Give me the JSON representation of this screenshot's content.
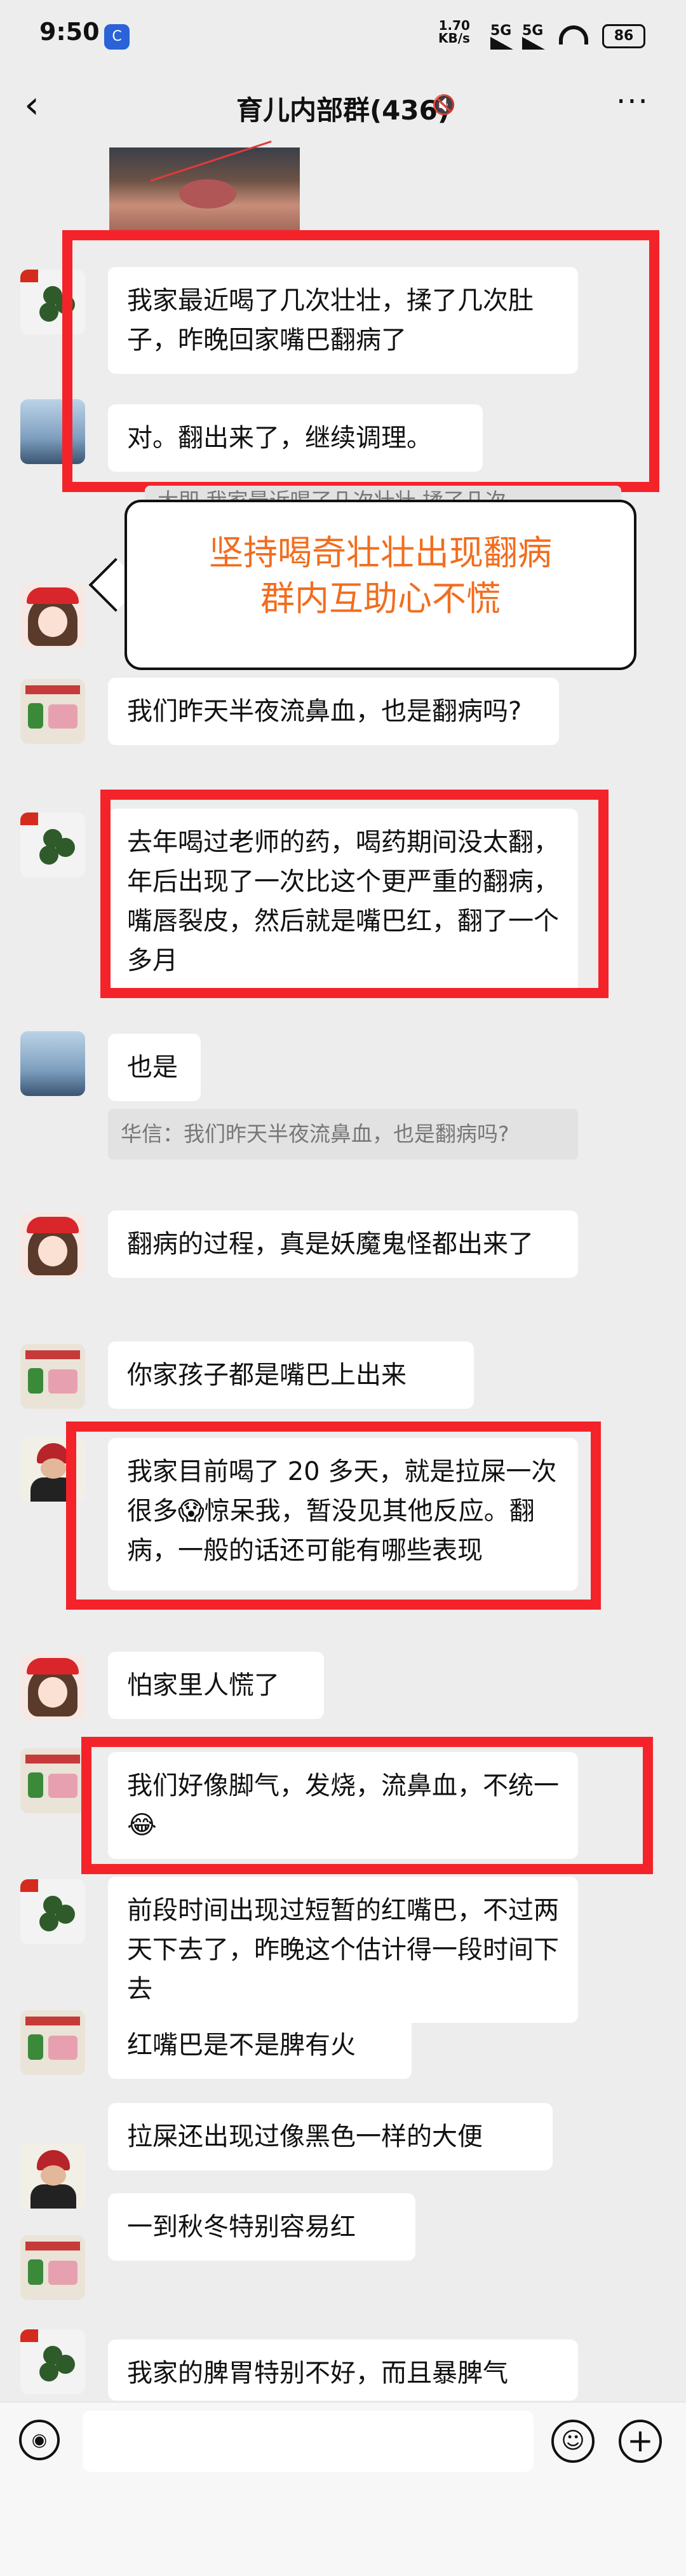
{
  "status": {
    "time": "9:50",
    "app_badge": "C",
    "net_speed": "1.70\nKB/s",
    "sig1": "5G",
    "sig2": "5G",
    "battery": "86"
  },
  "nav": {
    "title": "育儿内部群(436)",
    "back": "‹",
    "more": "···",
    "title_icons": "🔇"
  },
  "callout": {
    "line1": "坚持喝奇壮壮出现翻病",
    "line2": "群内互助心不慌"
  },
  "messages": [
    {
      "text": "我家最近喝了几次壮壮，揉了几次肚子，昨晚回家嘴巴翻病了"
    },
    {
      "text": "对。翻出来了，继续调理。"
    },
    {
      "text": "大即 我家最近喝了几次壮壮 揉了几次"
    },
    {
      "text": "我们昨天半夜流鼻血，也是翻病吗?"
    },
    {
      "text": "去年喝过老师的药，喝药期间没太翻，年后出现了一次比这个更严重的翻病，嘴唇裂皮，然后就是嘴巴红，翻了一个多月"
    },
    {
      "text": "也是"
    },
    {
      "text": "华信：我们昨天半夜流鼻血，也是翻病吗?"
    },
    {
      "text": "翻病的过程，真是妖魔鬼怪都出来了"
    },
    {
      "text": "你家孩子都是嘴巴上出来"
    },
    {
      "text": "我家目前喝了 20 多天，就是拉屎一次很多😱惊呆我，暂没见其他反应。翻病，一般的话还可能有哪些表现"
    },
    {
      "text": "怕家里人慌了"
    },
    {
      "text": "我们好像脚气，发烧，流鼻血，不统一😂"
    },
    {
      "text": "前段时间出现过短暂的红嘴巴，不过两天下去了，昨晚这个估计得一段时间下去"
    },
    {
      "text": "红嘴巴是不是脾有火"
    },
    {
      "text": "拉屎还出现过像黑色一样的大便"
    },
    {
      "text": "一到秋冬特别容易红"
    },
    {
      "text": "我家的脾胃特别不好，而且暴脾气"
    }
  ],
  "bottom": {
    "voice": "◉",
    "emoji": "☺",
    "plus": "+"
  }
}
